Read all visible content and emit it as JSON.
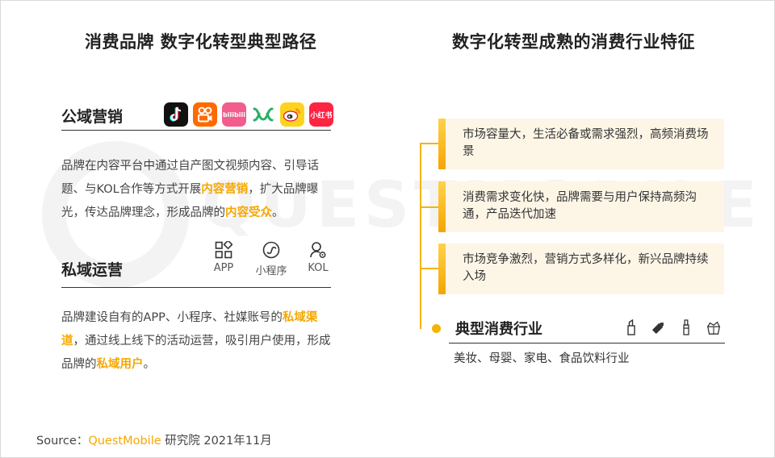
{
  "watermark": {
    "text": "QUESTMOBILE"
  },
  "left": {
    "title": "消费品牌 数字化转型典型路径",
    "public": {
      "heading": "公域营销",
      "apps": [
        {
          "name": "douyin-icon",
          "label": ""
        },
        {
          "name": "kuaishou-icon",
          "label": ""
        },
        {
          "name": "bilibili-icon",
          "label": "bilibili"
        },
        {
          "name": "wechat-channels-icon",
          "label": ""
        },
        {
          "name": "weibo-icon",
          "label": ""
        },
        {
          "name": "xiaohongshu-icon",
          "label": "小红书"
        }
      ],
      "para": {
        "t1": "品牌在内容平台中通过自产图文视频内容、引导话题、与KOL合作等方式开展",
        "h1": "内容营销",
        "t2": "，扩大品牌曝光，传达品牌理念，形成品牌的",
        "h2": "内容受众",
        "t3": "。"
      }
    },
    "private": {
      "heading": "私域运营",
      "icons": [
        {
          "name": "app-icon",
          "label": "APP"
        },
        {
          "name": "mini-program-icon",
          "label": "小程序"
        },
        {
          "name": "kol-icon",
          "label": "KOL"
        }
      ],
      "para": {
        "t1": "品牌建设自有的APP、小程序、社媒账号的",
        "h1": "私域渠道",
        "t2": "，通过线上线下的活动运营，吸引用户使用，形成品牌的",
        "h2": "私域用户",
        "t3": "。"
      }
    }
  },
  "right": {
    "title": "数字化转型成熟的消费行业特征",
    "cards": [
      "市场容量大，生活必备或需求强烈，高频消费场景",
      "消费需求变化快，品牌需要与用户保持高频沟通，产品迭代加速",
      "市场竞争激烈，营销方式多样化，新兴品牌持续入场"
    ],
    "industry": {
      "heading": "典型消费行业",
      "icons": [
        "lipstick-icon",
        "baby-bottle-icon",
        "cosmetic-tube-icon",
        "food-box-icon"
      ],
      "text": "美妆、母婴、家电、食品饮料行业"
    }
  },
  "source": {
    "prefix": "Source：",
    "brand": "QuestMobile",
    "suffix": " 研究院 2021年11月"
  },
  "colors": {
    "accent": "#f5a800",
    "card_bg": "#fdf6e7",
    "line": "#f5b400"
  }
}
